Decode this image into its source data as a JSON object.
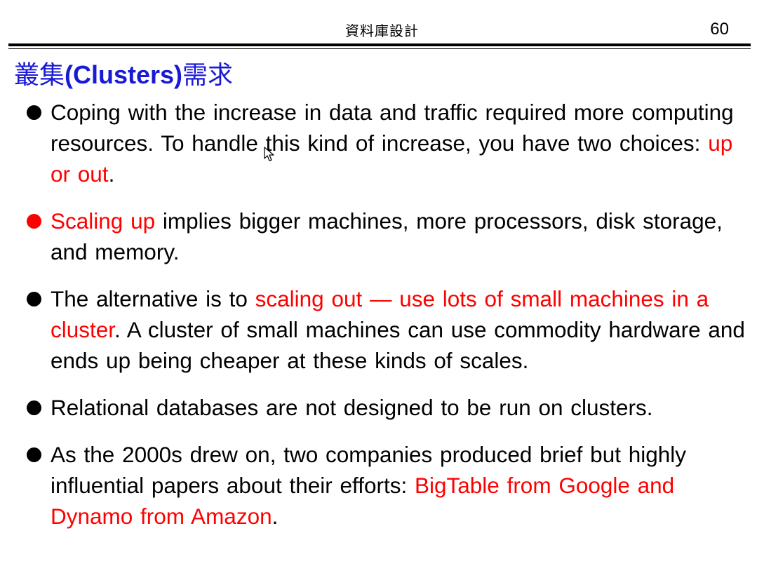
{
  "header": {
    "course_title": "資料庫設計",
    "page_number": "60"
  },
  "title": {
    "prefix": "叢集",
    "middle": "(Clusters)",
    "suffix": "需求"
  },
  "bullets": [
    {
      "t1": "Coping with the increase in data and traffic required more computing resources. To handle this kind of increase, you have two choices: ",
      "h1": "up or out",
      "t2": "."
    },
    {
      "h1": "Scaling up",
      "t1": " implies bigger machines, more processors, disk storage, and memory."
    },
    {
      "t1": "The alternative is to ",
      "h1": "scaling out — use lots of small machines in a cluster",
      "t2": ". A cluster of small machines can use commodity hardware and ends up being cheaper at these kinds of scales."
    },
    {
      "t1": "Relational databases are not designed to be run on clusters."
    },
    {
      "t1": "As the 2000s drew on, two companies produced brief but highly influential papers about their efforts: ",
      "h1": "BigTable from Google and Dynamo from Amazon",
      "t2": "."
    }
  ],
  "colors": {
    "title": "#1a1ad6",
    "highlight": "#ff0000",
    "text": "#000000"
  }
}
